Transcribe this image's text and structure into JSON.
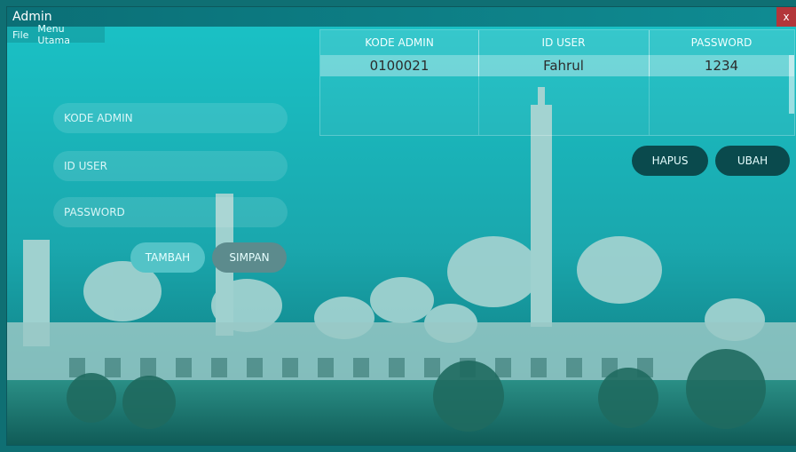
{
  "window": {
    "title": "Admin",
    "close_label": "x"
  },
  "menu": {
    "items": [
      "File",
      "Menu Utama"
    ]
  },
  "form": {
    "kode_admin_placeholder": "KODE ADMIN",
    "id_user_placeholder": "ID USER",
    "password_placeholder": "PASSWORD",
    "tambah_label": "TAMBAH",
    "simpan_label": "SIMPAN"
  },
  "table": {
    "columns": [
      "KODE ADMIN",
      "ID USER",
      "PASSWORD"
    ],
    "rows": [
      [
        "0100021",
        "Fahrul",
        "1234"
      ]
    ]
  },
  "actions": {
    "hapus_label": "HAPUS",
    "ubah_label": "UBAH"
  }
}
